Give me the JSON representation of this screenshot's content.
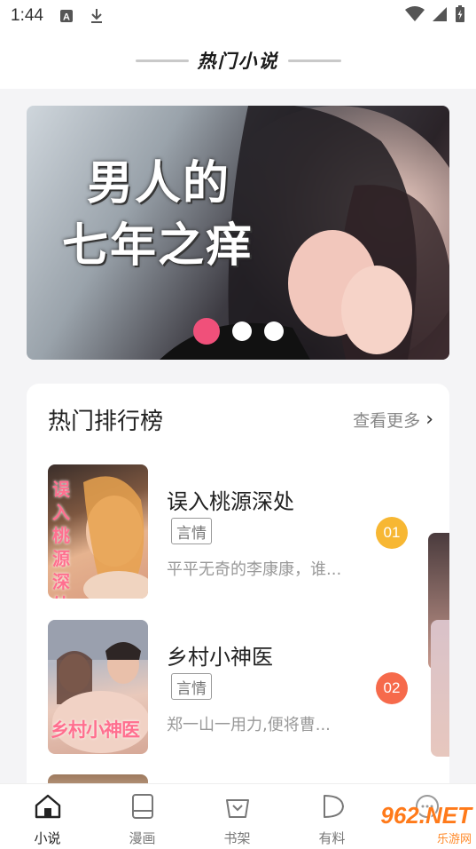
{
  "status_bar": {
    "time": "1:44"
  },
  "header": {
    "title": "热门小说"
  },
  "banner": {
    "title_line1": "男人的",
    "title_line2": "七年之痒",
    "active_page": 1,
    "page_count": 3
  },
  "ranking": {
    "title": "热门排行榜",
    "more_label": "查看更多",
    "books": [
      {
        "cover_text": "误入桃源深处",
        "title": "误入桃源深处",
        "tag": "言情",
        "desc": "平平无奇的李康康，谁...",
        "rank": "01",
        "rank_color": "#f7b733"
      },
      {
        "cover_text": "乡村小神医",
        "title": "乡村小神医",
        "tag": "言情",
        "desc": "郑一山一用力,便将曹...",
        "rank": "02",
        "rank_color": "#f66a4b"
      }
    ]
  },
  "bottom_nav": {
    "items": [
      {
        "label": "小说",
        "icon": "house-icon",
        "active": true
      },
      {
        "label": "漫画",
        "icon": "book-icon",
        "active": false
      },
      {
        "label": "书架",
        "icon": "basket-icon",
        "active": false
      },
      {
        "label": "有料",
        "icon": "play-bubble-icon",
        "active": false
      },
      {
        "label": "",
        "icon": "chat-icon",
        "active": false
      }
    ]
  },
  "watermark": {
    "main": "962.NET",
    "sub": "乐游网"
  },
  "colors": {
    "accent": "#f0507a",
    "background": "#f4f4f6"
  }
}
